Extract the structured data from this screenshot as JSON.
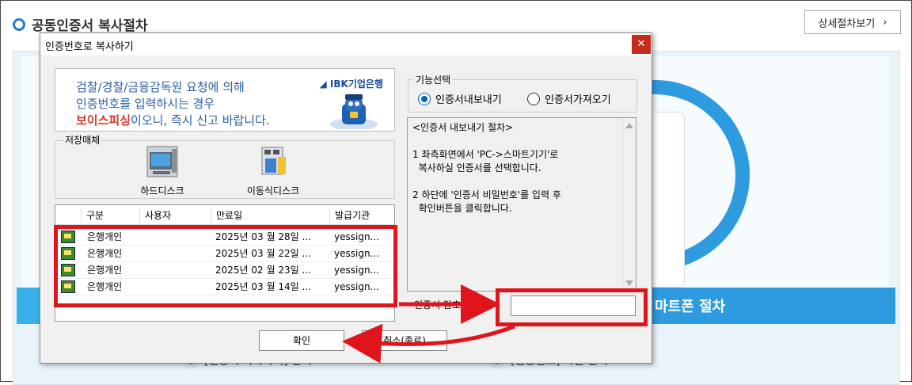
{
  "page": {
    "title": "공동인증서 복사절차",
    "detail_button": "상세절차보기",
    "band_text": "마트폰 절차",
    "step1_num": "1",
    "step1_text": "[인증서 복사하기] 선택",
    "step3_num": "3",
    "step3_text": "[인증번호] 화면 선택"
  },
  "dialog": {
    "title": "인증번호로 복사하기",
    "close_glyph": "✕",
    "banner": {
      "line1": "검찰/경찰/금융감독원 요청에 의해",
      "line2": "인증번호를 입력하시는 경우",
      "line3_red": "보이스피싱",
      "line3_rest": "이오니, 즉시 신고 바랍니다.",
      "logo": "IBK기업은행"
    },
    "storage": {
      "label": "저장매체",
      "hdd": "하드디스크",
      "usb": "이동식디스크"
    },
    "table": {
      "headers": [
        "구분",
        "사용자",
        "만료일",
        "발급기관"
      ],
      "rows": [
        {
          "type": "은행개인",
          "user": "",
          "expiry": "2025년 03 월 28일 ...",
          "issuer": "yessign..."
        },
        {
          "type": "은행개인",
          "user": "",
          "expiry": "2025년 03 월 22일 ...",
          "issuer": "yessign..."
        },
        {
          "type": "은행개인",
          "user": "",
          "expiry": "2025년 02 월 23일 ...",
          "issuer": "yessign..."
        },
        {
          "type": "은행개인",
          "user": "",
          "expiry": "2025년 03 월 14일 ...",
          "issuer": "yessign..."
        }
      ]
    },
    "function": {
      "label": "기능선택",
      "export": "인증서내보내기",
      "import": "인증서가져오기",
      "selected": "export"
    },
    "instructions": "<인증서 내보내기 절차>\n\n1 좌측화면에서 'PC->스마트기기'로\n  복사하실 인증서를 선택합니다.\n\n2 하단에 '인증서 비밀번호'를 입력 후\n  확인버튼을 클릭합니다.",
    "password_label": "인증서 암호",
    "password_value": "",
    "ok_button": "확인",
    "cancel_button": "취소(종료)"
  },
  "colors": {
    "highlight": "#e0151b",
    "band": "#2e9be0",
    "close": "#c42b1c"
  }
}
